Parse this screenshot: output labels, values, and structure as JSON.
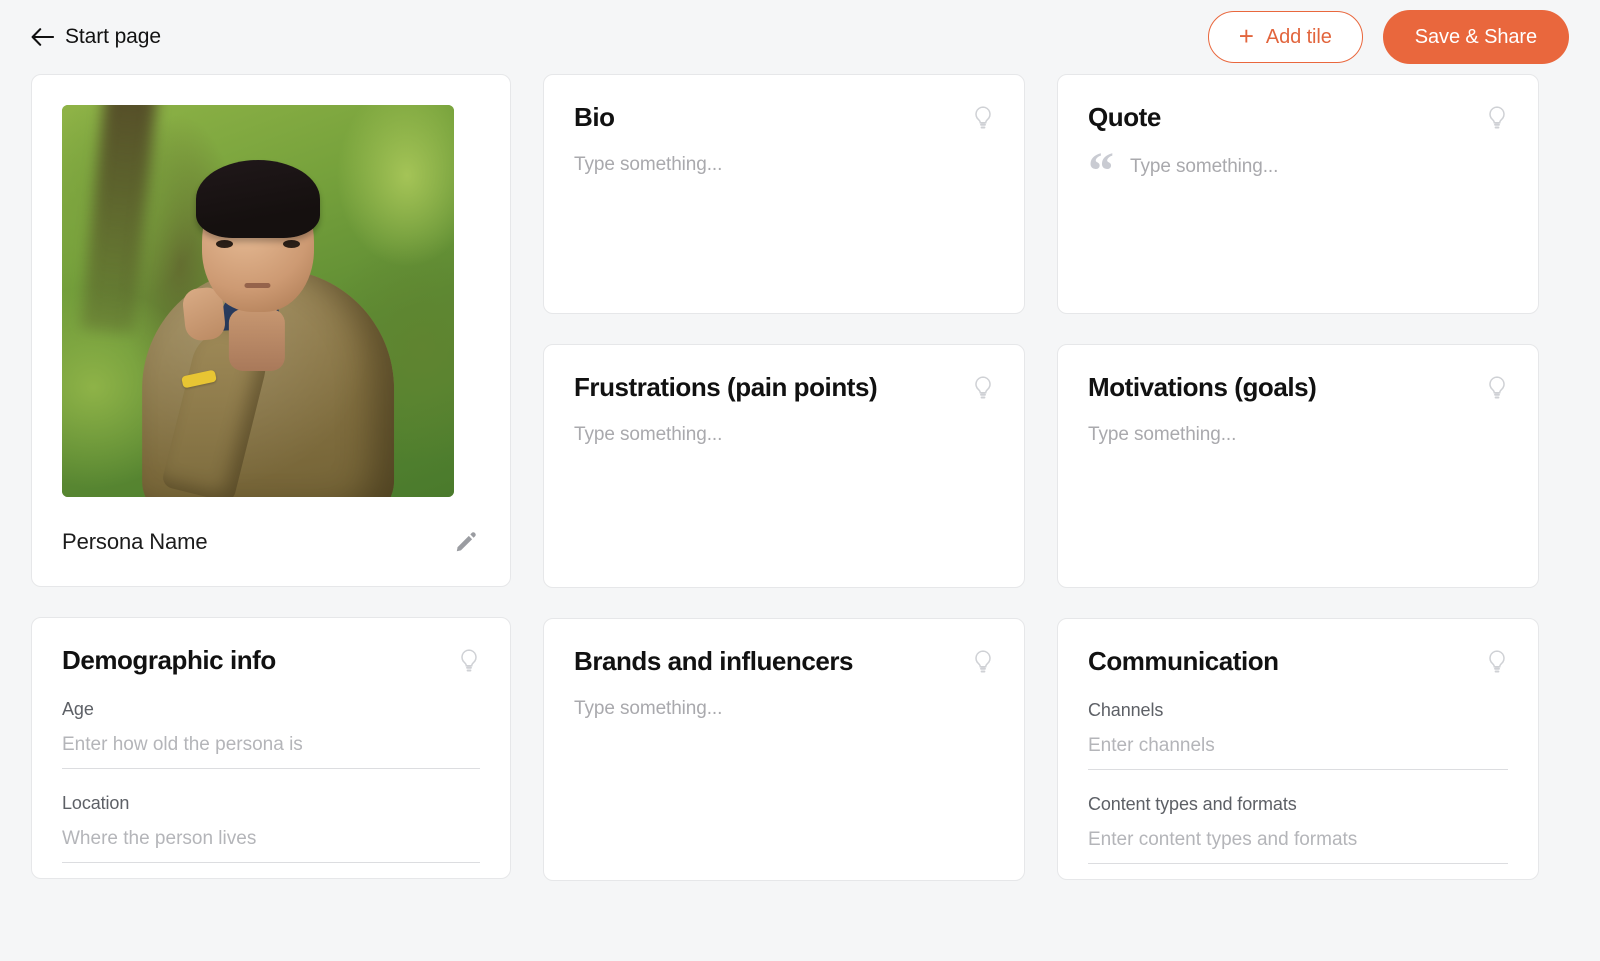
{
  "header": {
    "back_label": "Start page",
    "back_icon": "arrow-left-icon",
    "add_tile_label": "Add tile",
    "add_tile_icon": "plus-icon",
    "save_share_label": "Save & Share",
    "accent_color": "#e9673d",
    "background_color": "#f5f6f7"
  },
  "persona": {
    "name": "Persona Name",
    "edit_icon": "pencil-icon",
    "photo_alt": "portrait of a young man in an olive sweater with navy collar, blurred green foliage background"
  },
  "tiles": {
    "bio": {
      "title": "Bio",
      "placeholder": "Type something...",
      "hint_icon": "lightbulb-icon"
    },
    "quote": {
      "title": "Quote",
      "placeholder": "Type something...",
      "quote_mark": "“",
      "hint_icon": "lightbulb-icon"
    },
    "frustrations": {
      "title": "Frustrations (pain points)",
      "placeholder": "Type something...",
      "hint_icon": "lightbulb-icon"
    },
    "motivations": {
      "title": "Motivations (goals)",
      "placeholder": "Type something...",
      "hint_icon": "lightbulb-icon"
    },
    "brands": {
      "title": "Brands and influencers",
      "placeholder": "Type something...",
      "hint_icon": "lightbulb-icon"
    },
    "demographic": {
      "title": "Demographic info",
      "hint_icon": "lightbulb-icon",
      "fields": [
        {
          "label": "Age",
          "value": "",
          "placeholder": "Enter how old the persona is"
        },
        {
          "label": "Location",
          "value": "",
          "placeholder": "Where the person lives"
        }
      ]
    },
    "communication": {
      "title": "Communication",
      "hint_icon": "lightbulb-icon",
      "fields": [
        {
          "label": "Channels",
          "value": "",
          "placeholder": "Enter channels"
        },
        {
          "label": "Content types and formats",
          "value": "",
          "placeholder": "Enter content types and formats"
        }
      ]
    }
  }
}
